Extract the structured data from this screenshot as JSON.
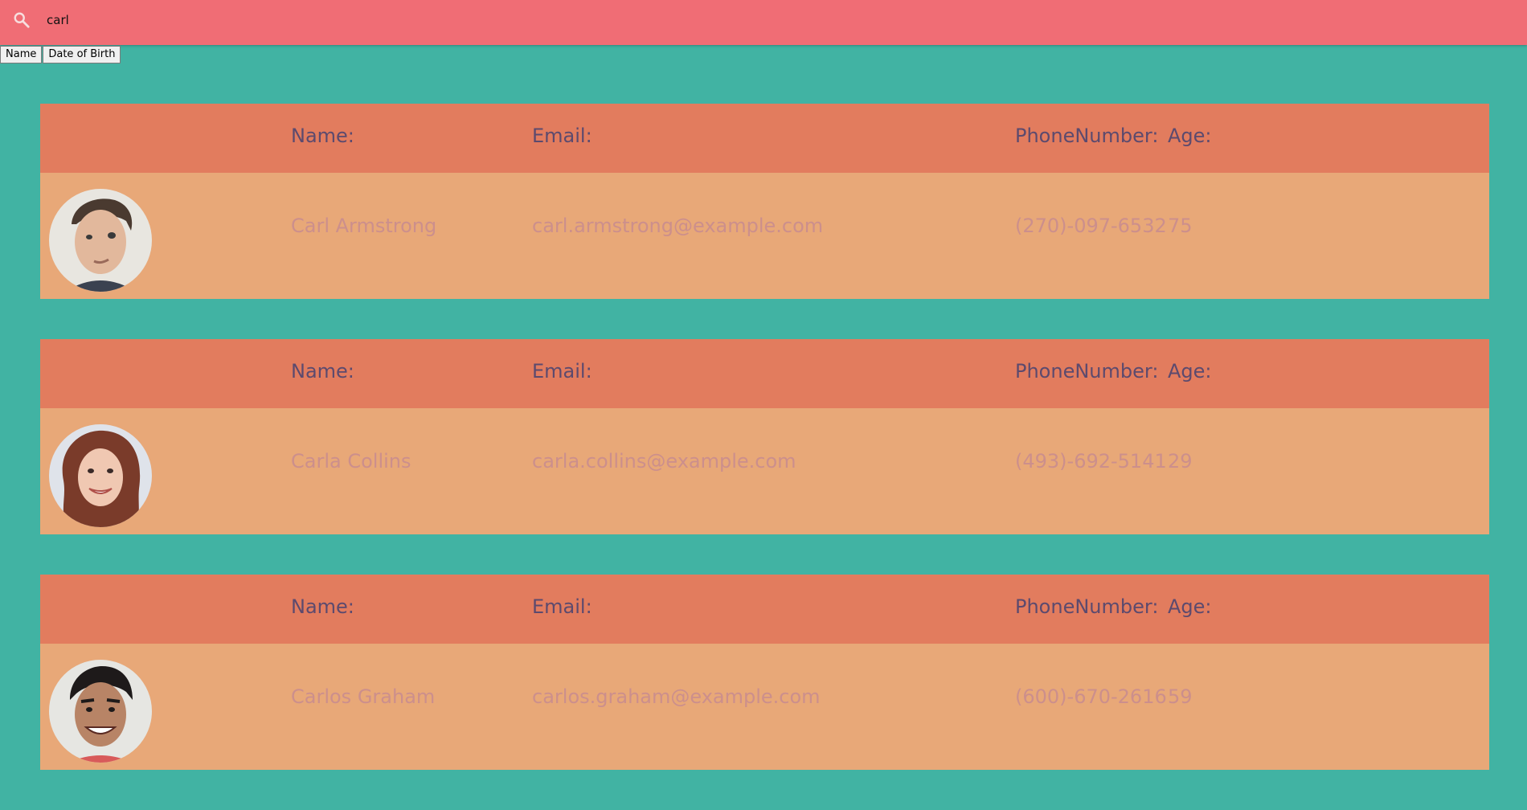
{
  "search": {
    "value": "carl",
    "icon": "search-icon"
  },
  "sort": {
    "buttons": [
      "Name",
      "Date of Birth"
    ]
  },
  "labels": {
    "name": "Name:",
    "email": "Email:",
    "phone": "PhoneNumber:",
    "age": "Age:"
  },
  "colors": {
    "topbar": "#f06d75",
    "background": "#41b3a3",
    "card_header": "#e27c5e",
    "card_body": "#e8a878"
  },
  "people": [
    {
      "name": "Carl Armstrong",
      "email": "carl.armstrong@example.com",
      "phone": "(270)-097-6532",
      "age": "75"
    },
    {
      "name": "Carla Collins",
      "email": "carla.collins@example.com",
      "phone": "(493)-692-5141",
      "age": "29"
    },
    {
      "name": "Carlos Graham",
      "email": "carlos.graham@example.com",
      "phone": "(600)-670-2616",
      "age": "59"
    }
  ]
}
